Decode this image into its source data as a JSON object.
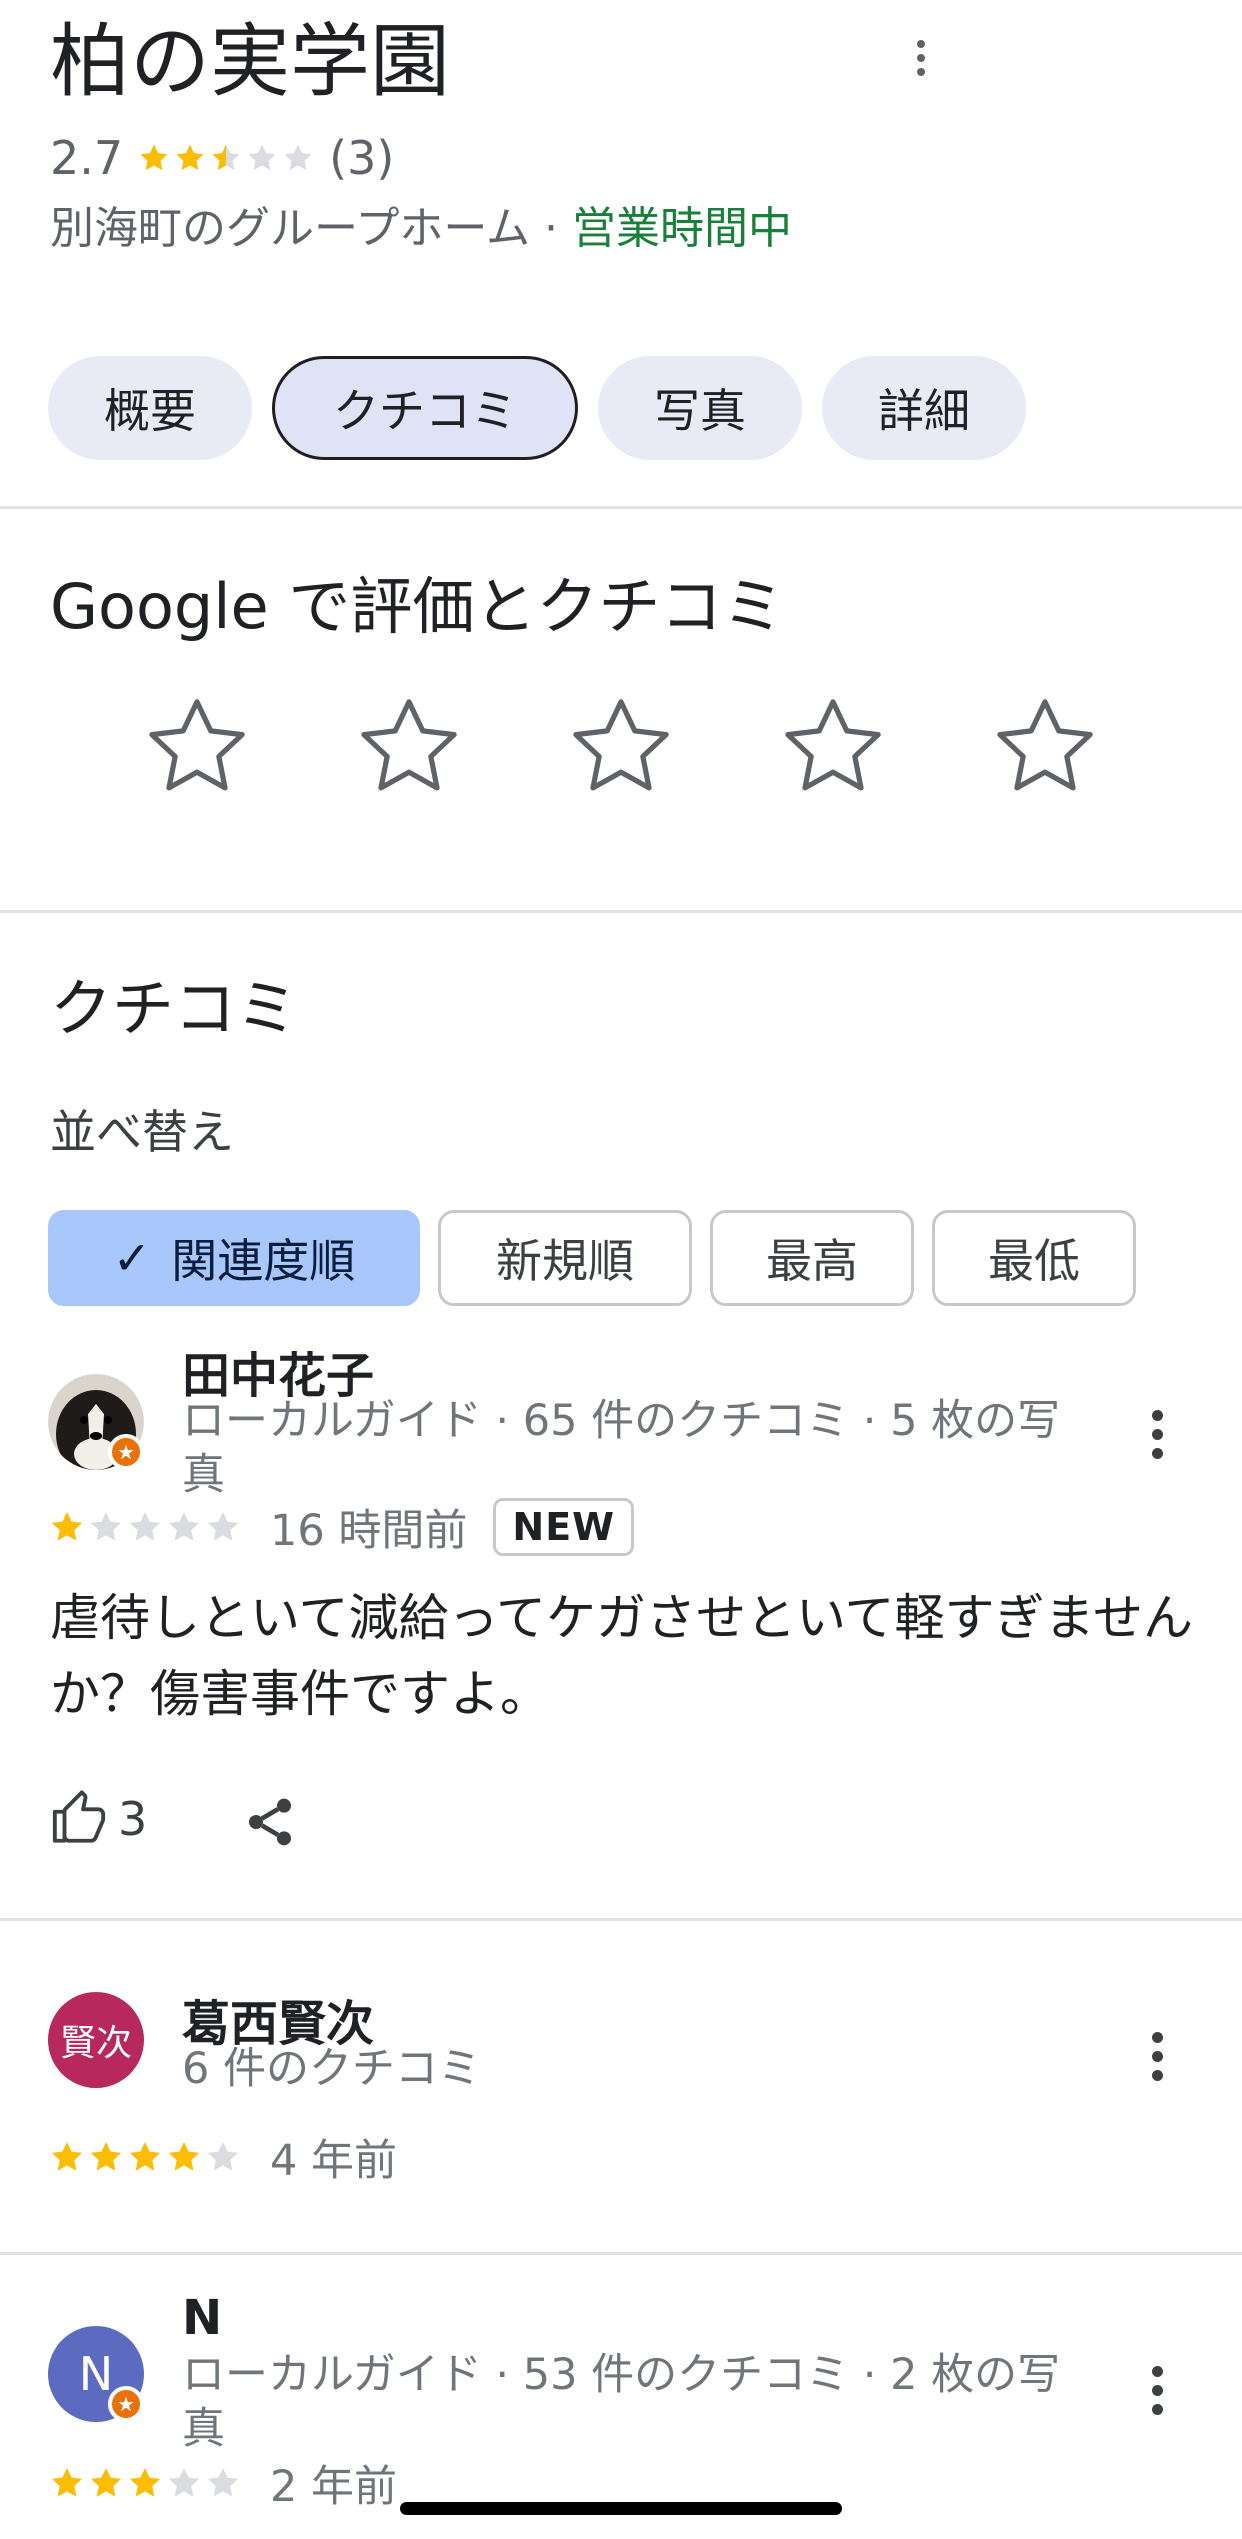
{
  "place": {
    "title": "柏の実学園",
    "rating": "2.7",
    "rating_value": 2.7,
    "review_count": "(3)",
    "category": "別海町のグループホーム · ",
    "status": "営業時間中"
  },
  "tabs": [
    {
      "label": "概要"
    },
    {
      "label": "クチコミ"
    },
    {
      "label": "写真"
    },
    {
      "label": "詳細"
    }
  ],
  "rate_section": {
    "heading": "Google で評価とクチコミ"
  },
  "reviews_section": {
    "heading": "クチコミ",
    "sort_label": "並べ替え",
    "sort_options": [
      {
        "label": "関連度順",
        "selected": true
      },
      {
        "label": "新規順",
        "selected": false
      },
      {
        "label": "最高",
        "selected": false
      },
      {
        "label": "最低",
        "selected": false
      }
    ]
  },
  "reviews": [
    {
      "author": "田中花子",
      "meta": "ローカルガイド · 65 件のクチコミ · 5 枚の写真",
      "stars": 1,
      "time": "16 時間前",
      "badge": "NEW",
      "text": "虐待しといて減給ってケガさせといて軽すぎませんか？傷害事件ですよ。",
      "likes": "3"
    },
    {
      "author": "葛西賢次",
      "avatar_text": "賢次",
      "avatar_color": "#b7295a",
      "meta": "6 件のクチコミ",
      "stars": 4,
      "time": "4 年前"
    },
    {
      "author": "N",
      "avatar_text": "N",
      "avatar_color": "#5c6bc0",
      "meta": "ローカルガイド · 53 件のクチコミ · 2 枚の写真",
      "stars": 3,
      "time": "2 年前"
    }
  ],
  "colors": {
    "star_filled": "#fbbc04",
    "star_empty": "#dadce0",
    "open_status": "#188038",
    "selected_sort": "#a8c7fa"
  }
}
